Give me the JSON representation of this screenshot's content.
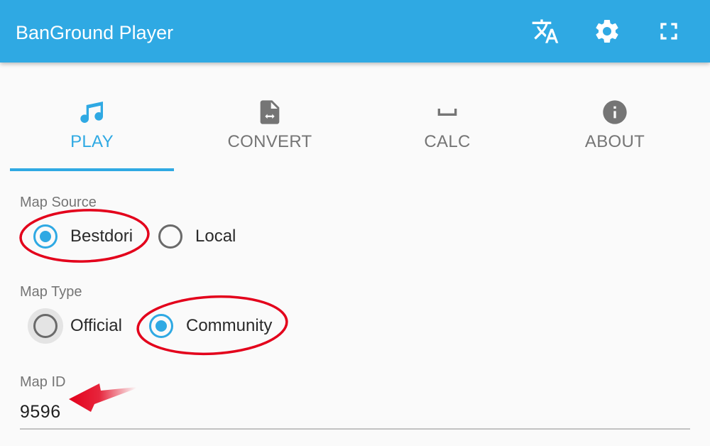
{
  "app": {
    "title": "BanGround Player",
    "actions": [
      {
        "icon": "translate-icon"
      },
      {
        "icon": "gear-icon"
      },
      {
        "icon": "fullscreen-icon"
      }
    ],
    "accent_color": "#2fa9e3",
    "annotation_color": "#e3001b"
  },
  "tabs": [
    {
      "label": "PLAY",
      "icon": "music-note-icon",
      "active": true
    },
    {
      "label": "CONVERT",
      "icon": "file-convert-icon",
      "active": false
    },
    {
      "label": "CALC",
      "icon": "space-bar-icon",
      "active": false
    },
    {
      "label": "ABOUT",
      "icon": "info-icon",
      "active": false
    }
  ],
  "form": {
    "map_source": {
      "label": "Map Source",
      "options": [
        "Bestdori",
        "Local"
      ],
      "selected": "Bestdori"
    },
    "map_type": {
      "label": "Map Type",
      "options": [
        "Official",
        "Community"
      ],
      "selected": "Community"
    },
    "map_id": {
      "label": "Map ID",
      "value": "9596"
    }
  }
}
